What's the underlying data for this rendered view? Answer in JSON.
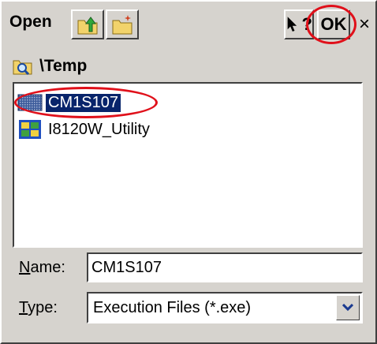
{
  "dialog": {
    "title": "Open",
    "ok_label": "OK",
    "close_label": "×",
    "help_label": "?"
  },
  "path": {
    "label": "\\Temp"
  },
  "files": [
    {
      "name": "CM1S107",
      "icon": "executable-icon",
      "selected": true
    },
    {
      "name": "I8120W_Utility",
      "icon": "folder-app-icon",
      "selected": false
    }
  ],
  "form": {
    "name_label_accel": "N",
    "name_label_rest": "ame:",
    "name_value": "CM1S107",
    "type_label_accel": "T",
    "type_label_rest": "ype:",
    "type_value": "Execution Files (*.exe)"
  },
  "colors": {
    "dialog_bg": "#d6d3ce",
    "selection_bg": "#08246b",
    "annotation_red": "#e0101a"
  }
}
